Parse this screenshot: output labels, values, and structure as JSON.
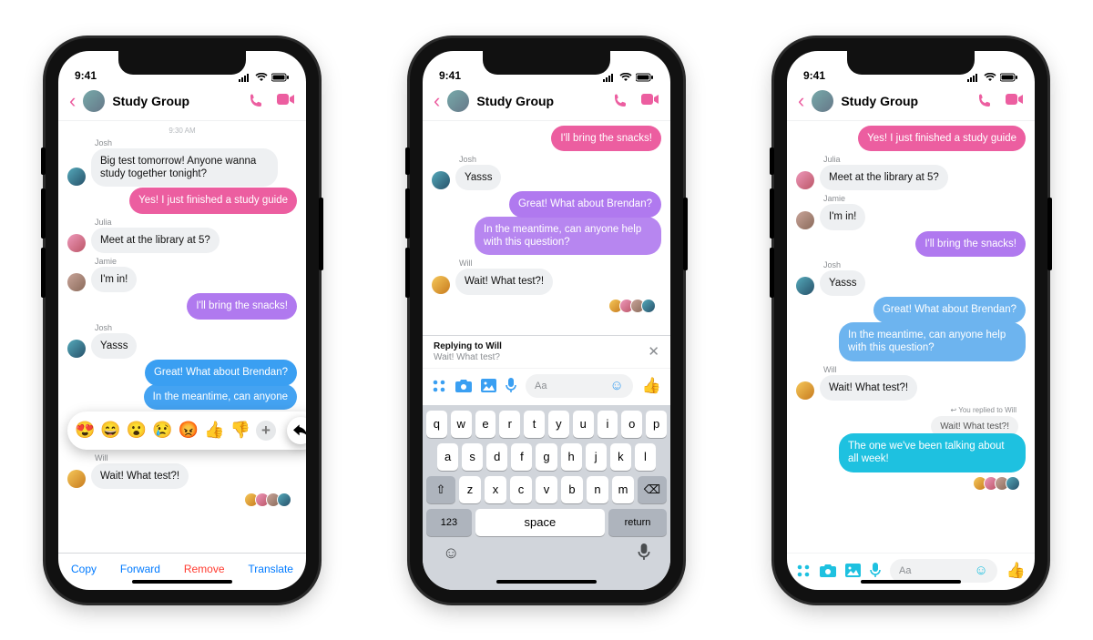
{
  "status": {
    "time": "9:41"
  },
  "header": {
    "title": "Study Group"
  },
  "phone1": {
    "timestamp_top": "9:30 AM",
    "msgs": {
      "josh1_sender": "Josh",
      "josh1": "Big test tomorrow! Anyone wanna study together tonight?",
      "me1": "Yes! I just finished a study guide",
      "julia_sender": "Julia",
      "julia": "Meet at the library at 5?",
      "jamie_sender": "Jamie",
      "jamie": "I'm in!",
      "me2": "I'll bring the snacks!",
      "josh2_sender": "Josh",
      "josh2": "Yasss",
      "me3": "Great! What about Brendan?",
      "me4_partial": "In the meantime, can anyone",
      "will_sender": "Will",
      "will": "Wait! What test?!"
    },
    "reactions": {
      "r1": "😍",
      "r2": "😄",
      "r3": "😮",
      "r4": "😢",
      "r5": "😡",
      "r6": "👍",
      "r7": "👎",
      "plus": "+",
      "reply": "↩"
    },
    "ctx": {
      "copy": "Copy",
      "forward": "Forward",
      "remove": "Remove",
      "translate": "Translate"
    }
  },
  "phone2": {
    "msgs": {
      "me1": "I'll bring the snacks!",
      "josh_sender": "Josh",
      "josh": "Yasss",
      "me2": "Great! What about Brendan?",
      "me3": "In the meantime, can anyone help with this question?",
      "will_sender": "Will",
      "will": "Wait! What test?!"
    },
    "reply_banner": {
      "line1": "Replying to Will",
      "line2": "Wait! What test?"
    },
    "input": {
      "placeholder": "Aa"
    },
    "keyboard": {
      "row1": [
        "q",
        "w",
        "e",
        "r",
        "t",
        "y",
        "u",
        "i",
        "o",
        "p"
      ],
      "row2": [
        "a",
        "s",
        "d",
        "f",
        "g",
        "h",
        "j",
        "k",
        "l"
      ],
      "row3_mid": [
        "z",
        "x",
        "c",
        "v",
        "b",
        "n",
        "m"
      ],
      "shift": "⇧",
      "backspace": "⌫",
      "numkey": "123",
      "space": "space",
      "return": "return",
      "emoji": "☺",
      "mic": "🎤"
    }
  },
  "phone3": {
    "msgs": {
      "me1": "Yes! I just finished a study guide",
      "julia_sender": "Julia",
      "julia": "Meet at the library at 5?",
      "jamie_sender": "Jamie",
      "jamie": "I'm in!",
      "me2": "I'll bring the snacks!",
      "josh_sender": "Josh",
      "josh": "Yasss",
      "me3": "Great! What about Brendan?",
      "me4": "In the meantime, can anyone help with this question?",
      "will_sender": "Will",
      "will": "Wait! What test?!",
      "reply_meta": "↩ You replied to Will",
      "quoted": "Wait! What test?!",
      "me5": "The one we've been talking about all week!"
    },
    "input": {
      "placeholder": "Aa"
    }
  }
}
